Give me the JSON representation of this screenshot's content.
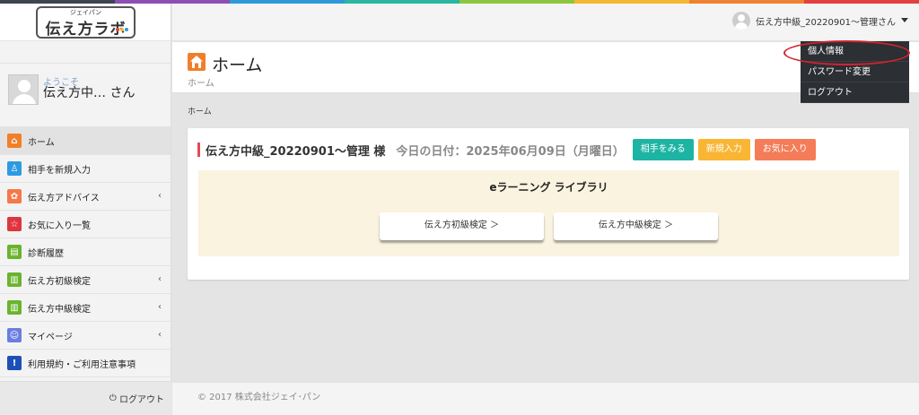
{
  "top_stripe_colors": [
    "#3d4550",
    "#8d4fb3",
    "#2d9ad8",
    "#2cb5a0",
    "#8cc63f",
    "#f5b731",
    "#ef8131",
    "#e4403e"
  ],
  "logo": {
    "kana": "ジェイパン",
    "text": "伝え方ラボ"
  },
  "user_panel": {
    "welcome": "ようこそ",
    "name": "伝え方中… さん"
  },
  "menu": [
    {
      "label": "ホーム",
      "icon": "home-icon",
      "color": "#f07f2a",
      "glyph": "⌂",
      "chevron": ""
    },
    {
      "label": "相手を新規入力",
      "icon": "user-add-icon",
      "color": "#2e9be0",
      "glyph": "♙",
      "chevron": ""
    },
    {
      "label": "伝え方アドバイス",
      "icon": "advice-icon",
      "color": "#f5784a",
      "glyph": "✿",
      "chevron": "‹"
    },
    {
      "label": "お気に入り一覧",
      "icon": "star-icon",
      "color": "#e0353f",
      "glyph": "☆",
      "chevron": ""
    },
    {
      "label": "診断履歴",
      "icon": "document-icon",
      "color": "#6ab42d",
      "glyph": "▤",
      "chevron": ""
    },
    {
      "label": "伝え方初級検定",
      "icon": "book-icon",
      "color": "#6ab42d",
      "glyph": "▥",
      "chevron": "‹"
    },
    {
      "label": "伝え方中級検定",
      "icon": "book-icon",
      "color": "#6ab42d",
      "glyph": "▥",
      "chevron": "‹"
    },
    {
      "label": "マイページ",
      "icon": "mypage-icon",
      "color": "#6b7de0",
      "glyph": "☺",
      "chevron": "‹"
    },
    {
      "label": "利用規約・ご利用注意事項",
      "icon": "notice-icon",
      "color": "#1d4fb6",
      "glyph": "!",
      "chevron": ""
    }
  ],
  "sidebar_logout": "ログアウト",
  "header": {
    "user_label": "伝え方中級_20220901～管理さん"
  },
  "dropdown": [
    "個人情報",
    "パスワード変更",
    "ログアウト"
  ],
  "page": {
    "title": "ホーム",
    "subtitle": "ホーム",
    "breadcrumb": "ホーム"
  },
  "card": {
    "greeting": "伝え方中級_20220901～管理 様",
    "today": "今日の日付：2025年06月09日（月曜日）",
    "buttons": [
      "相手をみる",
      "新規入力",
      "お気に入り"
    ]
  },
  "elearning": {
    "title": "eラーニング ライブラリ",
    "course1": "伝え方初級検定 ＞",
    "course2": "伝え方中級検定 ＞"
  },
  "footer": "© 2017 株式会社ジェイ･パン"
}
